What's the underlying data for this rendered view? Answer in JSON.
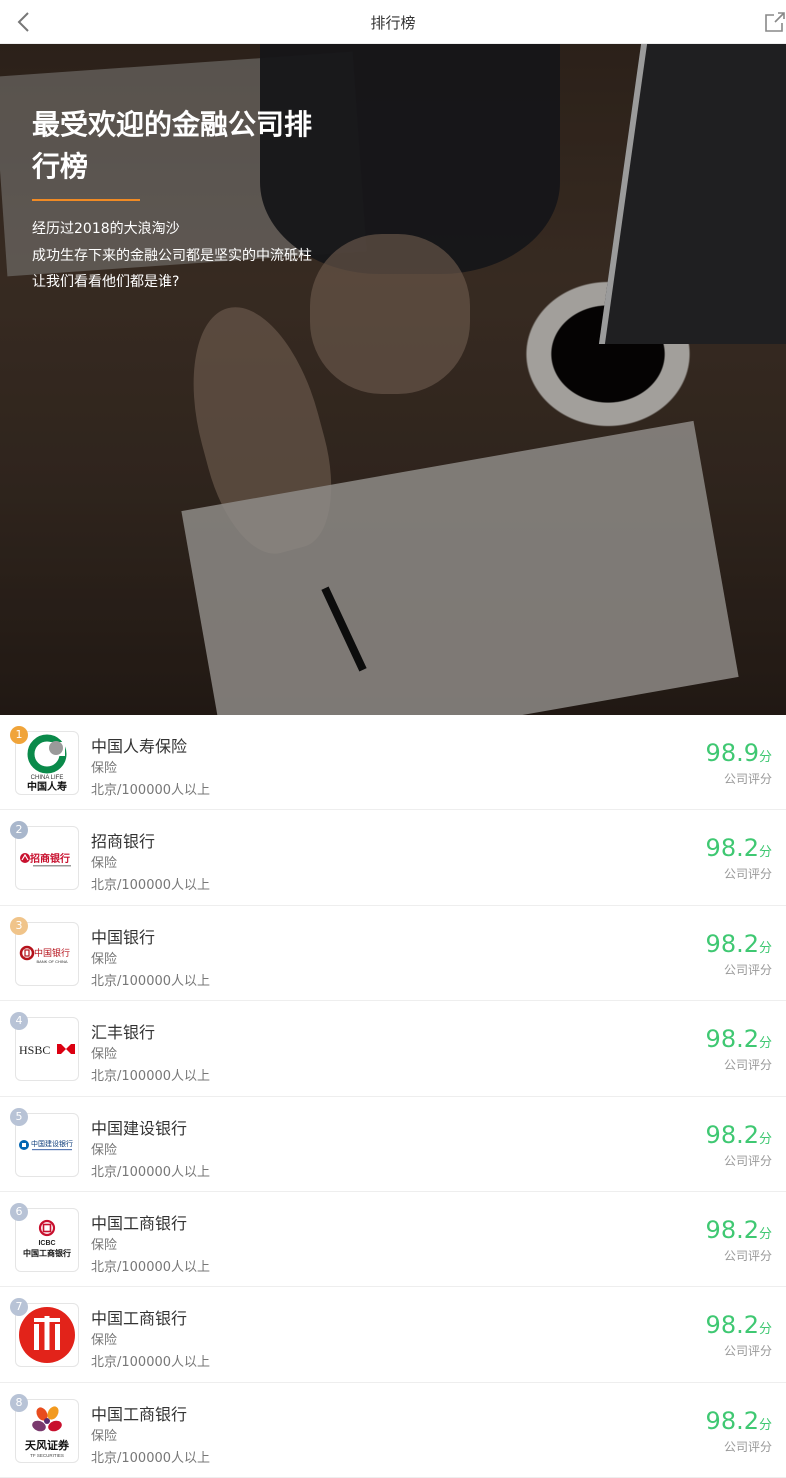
{
  "nav": {
    "title": "排行榜",
    "back_icon": "chevron-left-icon",
    "share_icon": "share-icon"
  },
  "hero": {
    "title": "最受欢迎的金融公司排行榜",
    "desc": [
      "经历过2018的大浪淘沙",
      "成功生存下来的金融公司都是坚实的中流砥柱",
      "让我们看看他们都是谁?"
    ],
    "accent_color": "#f08a24"
  },
  "score_label": "公司评分",
  "score_unit": "分",
  "score_color": "#3fc872",
  "companies": [
    {
      "rank": "1",
      "name": "中国人寿保险",
      "category": "保险",
      "location": "北京/100000人以上",
      "score": "98.9",
      "logo": "china-life-logo",
      "logo_text_en": "CHINA LIFE",
      "logo_text_cn": "中国人寿",
      "rank_color": "#f0a43a"
    },
    {
      "rank": "2",
      "name": "招商银行",
      "category": "保险",
      "location": "北京/100000人以上",
      "score": "98.2",
      "logo": "cmb-logo",
      "logo_text_cn": "招商银行",
      "rank_color": "#a9b7cc"
    },
    {
      "rank": "3",
      "name": "中国银行",
      "category": "保险",
      "location": "北京/100000人以上",
      "score": "98.2",
      "logo": "boc-logo",
      "logo_text_cn": "中国银行",
      "logo_text_en": "BANK OF CHINA",
      "rank_color": "#f0c48a"
    },
    {
      "rank": "4",
      "name": "汇丰银行",
      "category": "保险",
      "location": "北京/100000人以上",
      "score": "98.2",
      "logo": "hsbc-logo",
      "logo_text_en": "HSBC",
      "rank_color": "#b8c3d6"
    },
    {
      "rank": "5",
      "name": "中国建设银行",
      "category": "保险",
      "location": "北京/100000人以上",
      "score": "98.2",
      "logo": "ccb-logo",
      "logo_text_cn": "中国建设银行",
      "rank_color": "#b8c3d6"
    },
    {
      "rank": "6",
      "name": "中国工商银行",
      "category": "保险",
      "location": "北京/100000人以上",
      "score": "98.2",
      "logo": "icbc-logo",
      "logo_text_en": "ICBC",
      "logo_text_cn": "中国工商银行",
      "rank_color": "#b8c3d6"
    },
    {
      "rank": "7",
      "name": "中国工商银行",
      "category": "保险",
      "location": "北京/100000人以上",
      "score": "98.2",
      "logo": "citic-logo",
      "rank_color": "#b8c3d6"
    },
    {
      "rank": "8",
      "name": "中国工商银行",
      "category": "保险",
      "location": "北京/100000人以上",
      "score": "98.2",
      "logo": "tf-securities-logo",
      "logo_text_cn": "天风证券",
      "logo_text_en": "TF SECURITIES",
      "rank_color": "#b8c3d6"
    }
  ]
}
